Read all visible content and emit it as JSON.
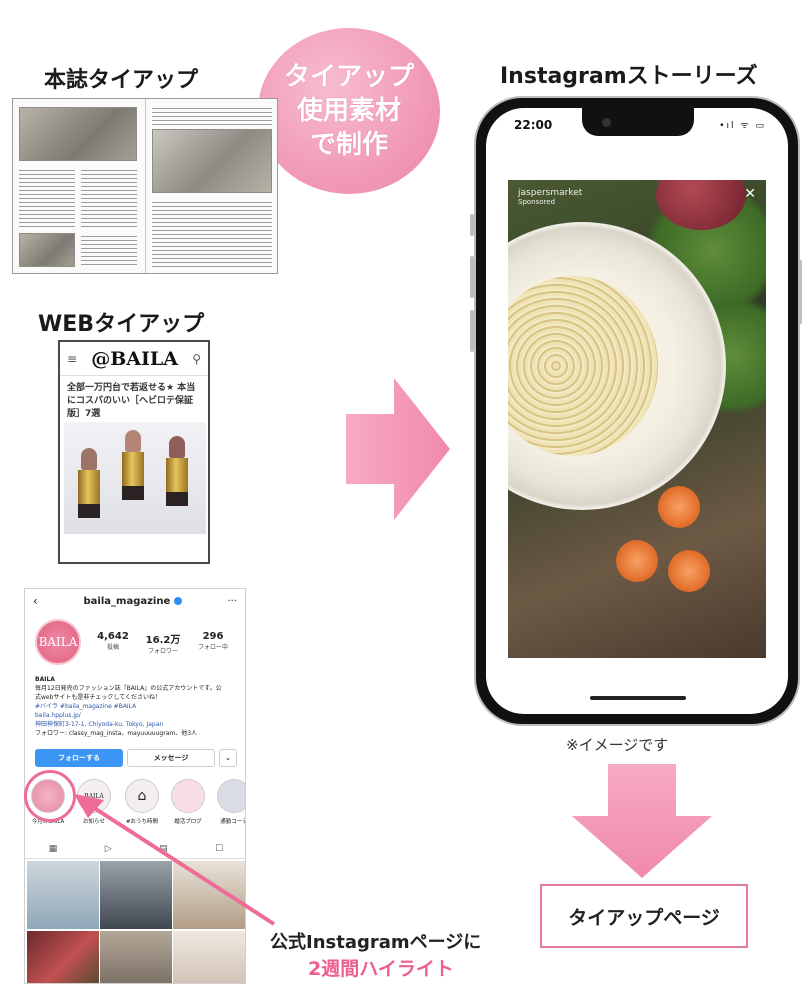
{
  "headings": {
    "magazine": "本誌タイアップ",
    "web": "WEBタイアップ",
    "stories": "Instagramストーリーズ"
  },
  "circle": {
    "line1": "タイアップ",
    "line2": "使用素材",
    "line3": "で制作"
  },
  "web_article": {
    "logo": "@BAILA",
    "menu_icon": "≡",
    "search_icon": "⚲",
    "title": "全部一万円台で若返せる★ 本当にコスパのいい［ヘビロテ保証版］7選"
  },
  "instagram": {
    "handle": "baila_magazine",
    "avatar_text": "BAILA",
    "stats": [
      {
        "value": "4,642",
        "label": "投稿"
      },
      {
        "value": "16.2万",
        "label": "フォロワー"
      },
      {
        "value": "296",
        "label": "フォロー中"
      }
    ],
    "bio_name": "BAILA",
    "bio_lines": [
      "毎月12日発売のファッション誌『BAILA』の公式アカウントです。公",
      "式webサイトも是非チェックしてくださいね！",
      "#バイラ #baila_magazine #BAILA",
      "baila.hpplus.jp/",
      "神田神保町3-17-1, Chiyoda-ku, Tokyo, Japan",
      "フォロワー: classy_mag_insta、mayuuuuugram、他3人"
    ],
    "follow_button": "フォローする",
    "message_button": "メッセージ",
    "highlights": [
      "今月のBAILA",
      "お知らせ",
      "#おうち時間",
      "婚活ブログ",
      "通勤コーデ"
    ]
  },
  "phone": {
    "time": "22:00",
    "status": "•ıl ᯤ ▭",
    "sponsor_name": "jaspersmarket",
    "sponsor_label": "Sponsored",
    "close": "✕"
  },
  "note": "※イメージです",
  "tieup_page": "タイアップページ",
  "caption": {
    "line1": "公式Instagramページに",
    "line2": "2週間ハイライト"
  },
  "colors": {
    "accent_pink": "#ee5f91",
    "circle_pink": "#f095b4"
  }
}
